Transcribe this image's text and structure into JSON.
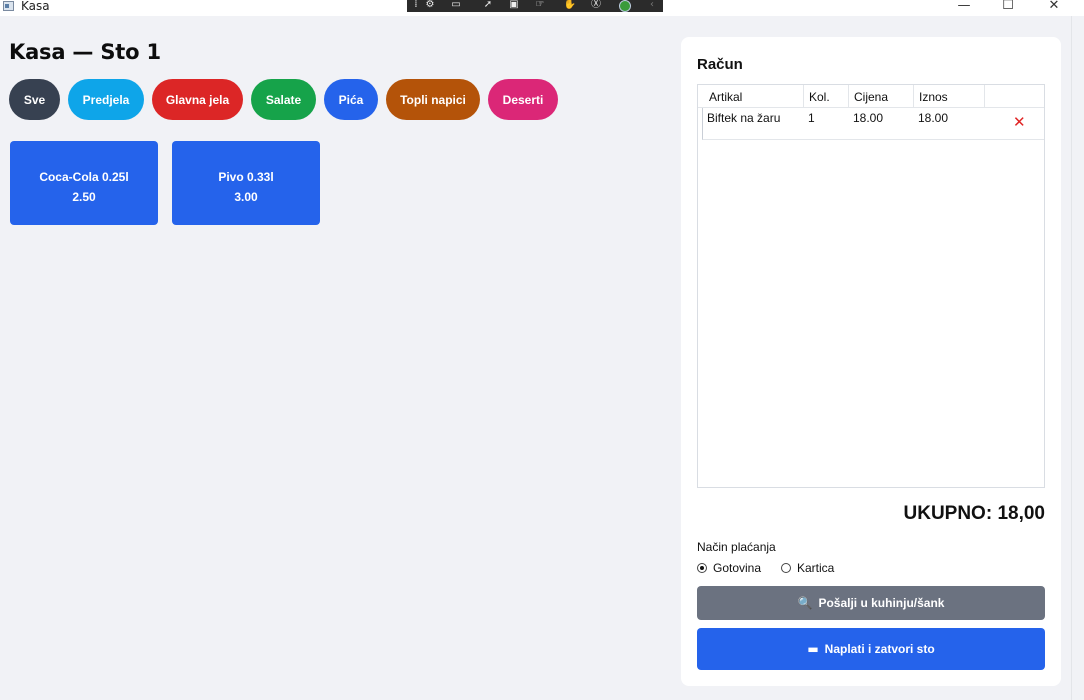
{
  "window": {
    "title": "Kasa",
    "minimize": "—",
    "maximize": "☐",
    "close": "✕"
  },
  "page": {
    "title": "Kasa — Sto 1"
  },
  "categories": [
    {
      "label": "Sve",
      "color": "#374151"
    },
    {
      "label": "Predjela",
      "color": "#0ea5e9"
    },
    {
      "label": "Glavna jela",
      "color": "#dc2626"
    },
    {
      "label": "Salate",
      "color": "#16a34a"
    },
    {
      "label": "Pića",
      "color": "#2563eb"
    },
    {
      "label": "Topli napici",
      "color": "#b45309"
    },
    {
      "label": "Deserti",
      "color": "#db2777"
    }
  ],
  "products": [
    {
      "name": "Coca-Cola 0.25l",
      "price": "2.50"
    },
    {
      "name": "Pivo 0.33l",
      "price": "3.00"
    }
  ],
  "bill": {
    "title": "Račun",
    "columns": [
      "Artikal",
      "Kol.",
      "Cijena",
      "Iznos"
    ],
    "rows": [
      {
        "item": "Biftek na žaru",
        "qty": "1",
        "price": "18.00",
        "amount": "18.00"
      }
    ],
    "delete_icon": "close-icon",
    "total": "UKUPNO: 18,00"
  },
  "payment": {
    "label": "Način plaćanja",
    "options": [
      "Gotovina",
      "Kartica"
    ],
    "selected": "Gotovina"
  },
  "actions": {
    "send": "Pošalji u kuhinju/šank",
    "pay": "Naplati i zatvori sto"
  }
}
